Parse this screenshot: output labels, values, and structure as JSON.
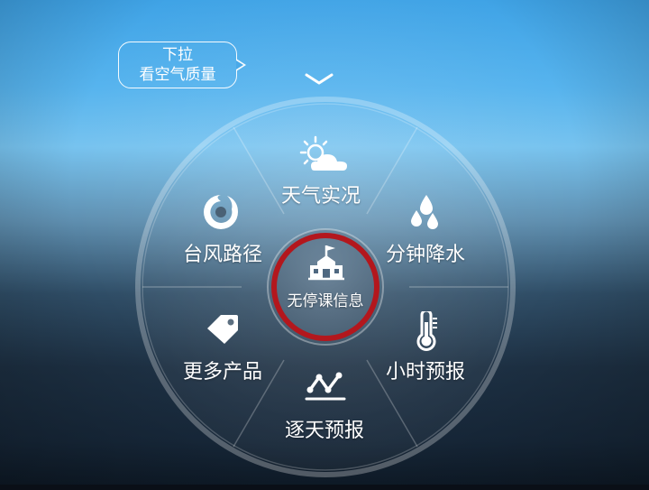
{
  "hint": {
    "line1": "下拉",
    "line2": "看空气质量"
  },
  "wheel": {
    "center": {
      "label": "无停课信息",
      "icon": "school-icon"
    },
    "segments": [
      {
        "id": "weather",
        "label": "天气实况",
        "icon": "weather-sun-cloud-icon"
      },
      {
        "id": "rain",
        "label": "分钟降水",
        "icon": "rain-drops-icon"
      },
      {
        "id": "hourly",
        "label": "小时预报",
        "icon": "thermometer-icon"
      },
      {
        "id": "daily",
        "label": "逐天预报",
        "icon": "trend-line-icon"
      },
      {
        "id": "more",
        "label": "更多产品",
        "icon": "tag-icon"
      },
      {
        "id": "typhoon",
        "label": "台风路径",
        "icon": "typhoon-icon"
      }
    ]
  },
  "colors": {
    "highlight_ring": "#b3171d",
    "label": "#ffffff"
  }
}
